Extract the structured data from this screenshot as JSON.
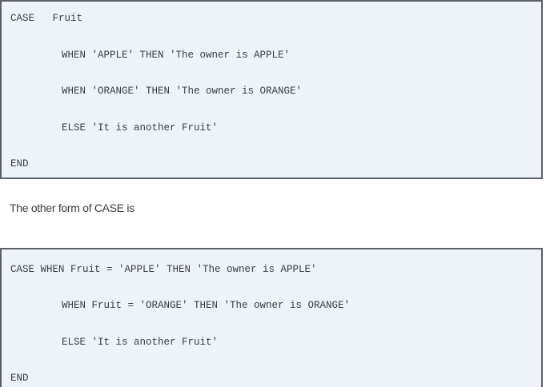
{
  "first_block": {
    "lines": [
      "CASE   Fruit",
      "WHEN 'APPLE' THEN 'The owner is APPLE'",
      "WHEN 'ORANGE' THEN 'The owner is ORANGE'",
      "ELSE 'It is another Fruit'",
      "END"
    ]
  },
  "between_text": "The other form of CASE is",
  "second_block": {
    "lines": [
      "CASE WHEN Fruit = 'APPLE' THEN 'The owner is APPLE'",
      "WHEN Fruit = 'ORANGE' THEN 'The owner is ORANGE'",
      "ELSE 'It is another Fruit'",
      "END"
    ]
  }
}
